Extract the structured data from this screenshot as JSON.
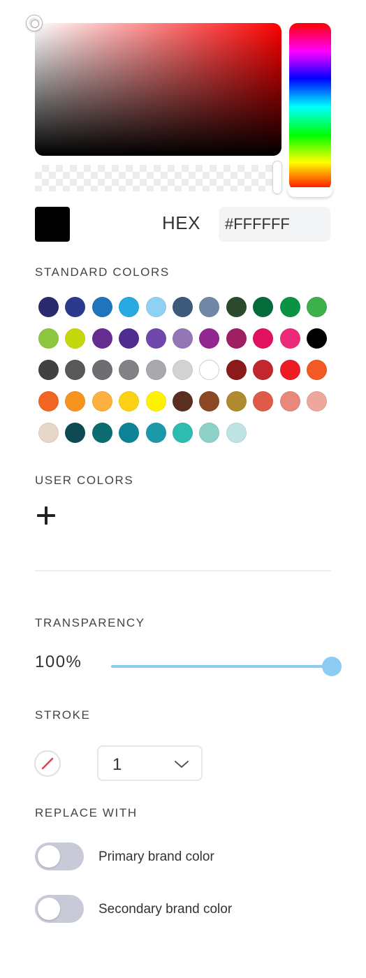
{
  "color_picker": {
    "hue_color": "#FF0000",
    "preview_color": "#000000",
    "hex_label": "HEX",
    "hex_value": "#FFFFFF"
  },
  "standard_colors": {
    "heading": "STANDARD COLORS",
    "swatches": [
      "#2A2A6E",
      "#2C3A8E",
      "#1E75BC",
      "#27AAE1",
      "#8ED1F5",
      "#3D5A7A",
      "#7088A6",
      "#2B4A2D",
      "#046B3A",
      "#0A9345",
      "#3DB04B",
      "#8DC63F",
      "#C5D80E",
      "#662D91",
      "#4E2D8F",
      "#6E48AA",
      "#9376B6",
      "#92278F",
      "#9E1F63",
      "#E0115F",
      "#EC2A7A",
      "#000000",
      "#414042",
      "#58595B",
      "#6D6E71",
      "#808285",
      "#A7A9AC",
      "#D1D3D4",
      "#FFFFFF",
      "#8B1A1A",
      "#C1272D",
      "#ED1C24",
      "#F15A24",
      "#F26522",
      "#F7941E",
      "#FBB040",
      "#FCD116",
      "#FFF200",
      "#5A2F1F",
      "#8B4A23",
      "#B08A2E",
      "#DE5B49",
      "#E8887D",
      "#EDA79D",
      "#E6D7C6",
      "#0E4A53",
      "#0B6D70",
      "#0C8397",
      "#1A9AA8",
      "#2CBCB0",
      "#8DD1C9",
      "#BFE3E2"
    ]
  },
  "user_colors": {
    "heading": "USER COLORS",
    "add_icon": "plus-icon"
  },
  "transparency": {
    "heading": "TRANSPARENCY",
    "value_label": "100%",
    "value": 100,
    "accent": "#8CCBF2"
  },
  "stroke": {
    "heading": "STROKE",
    "none_icon": "no-stroke-icon",
    "width_value": "1",
    "dropdown_icon": "chevron-down-icon"
  },
  "replace_with": {
    "heading": "REPLACE WITH",
    "options": [
      {
        "label": "Primary brand color",
        "enabled": false
      },
      {
        "label": "Secondary brand color",
        "enabled": false
      }
    ]
  }
}
